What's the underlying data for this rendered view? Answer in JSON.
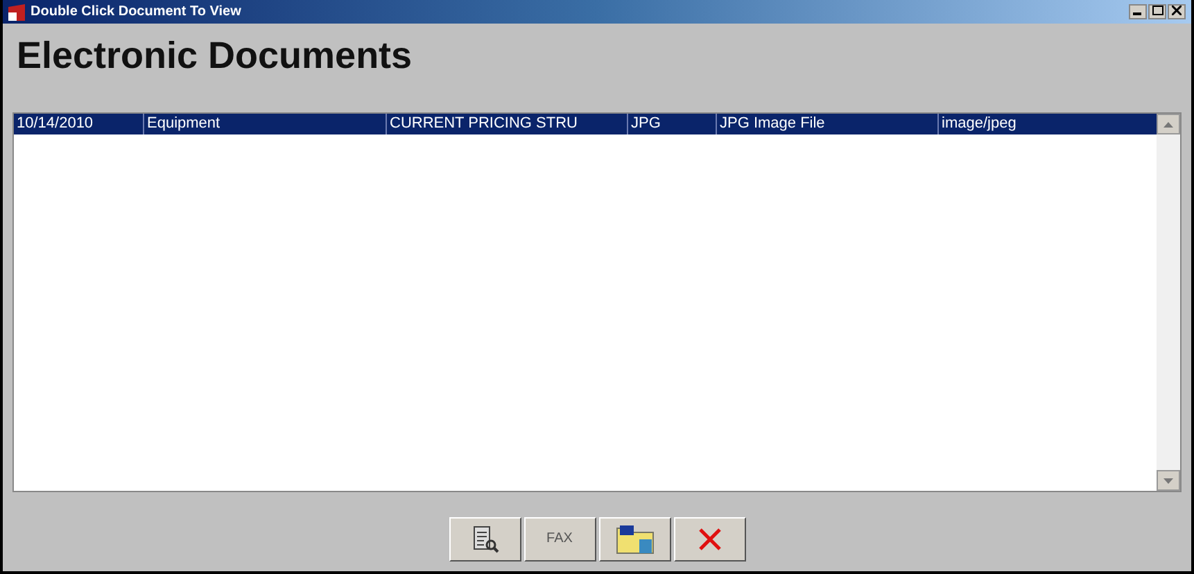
{
  "window": {
    "title": "Double Click Document To View"
  },
  "heading": "Electronic Documents",
  "table": {
    "rows": [
      {
        "selected": true,
        "cells": [
          "10/14/2010",
          "Equipment",
          "CURRENT PRICING STRU",
          "JPG",
          "JPG Image File",
          "image/jpeg"
        ]
      }
    ]
  },
  "buttons": [
    {
      "kind": "view"
    },
    {
      "kind": "text",
      "label": "FAX"
    },
    {
      "kind": "folder"
    },
    {
      "kind": "close"
    }
  ]
}
